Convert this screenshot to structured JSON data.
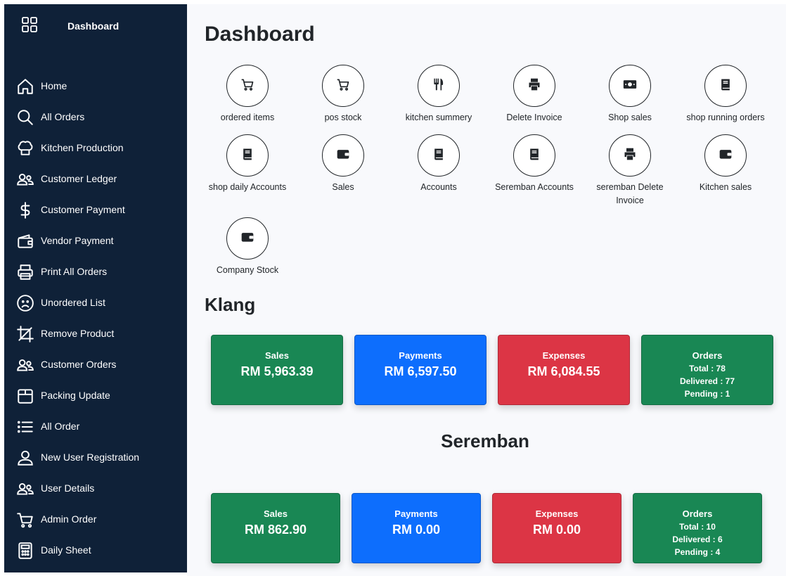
{
  "sidebar": {
    "brand": {
      "icon": "grid-icon",
      "title": "Dashboard"
    },
    "items": [
      {
        "label": "Home",
        "icon": "home-icon"
      },
      {
        "label": "All Orders",
        "icon": "search-icon"
      },
      {
        "label": "Kitchen Production",
        "icon": "chef-hat-icon"
      },
      {
        "label": "Customer Ledger",
        "icon": "users-icon"
      },
      {
        "label": "Customer Payment",
        "icon": "dollar-icon"
      },
      {
        "label": "Vendor Payment",
        "icon": "wallet-icon"
      },
      {
        "label": "Print All Orders",
        "icon": "printer-icon"
      },
      {
        "label": "Unordered List",
        "icon": "sad-face-icon"
      },
      {
        "label": "Remove Product",
        "icon": "crop-icon"
      },
      {
        "label": "Customer Orders",
        "icon": "users-icon"
      },
      {
        "label": "Packing Update",
        "icon": "box-icon"
      },
      {
        "label": "All Order",
        "icon": "list-icon"
      },
      {
        "label": "New User Registration",
        "icon": "user-icon"
      },
      {
        "label": "User Details",
        "icon": "users-icon"
      },
      {
        "label": "Admin Order",
        "icon": "cart-icon"
      },
      {
        "label": "Daily Sheet",
        "icon": "calculator-icon"
      }
    ]
  },
  "main": {
    "title": "Dashboard",
    "quick_links": [
      {
        "label": "ordered items",
        "icon": "cart-icon"
      },
      {
        "label": "pos stock",
        "icon": "cart-icon"
      },
      {
        "label": "kitchen summery",
        "icon": "utensils-icon"
      },
      {
        "label": "Delete Invoice",
        "icon": "printer-icon"
      },
      {
        "label": "Shop sales",
        "icon": "money-icon"
      },
      {
        "label": "shop running orders",
        "icon": "book-icon"
      },
      {
        "label": "shop daily Accounts",
        "icon": "book-icon"
      },
      {
        "label": "Sales",
        "icon": "wallet-icon"
      },
      {
        "label": "Accounts",
        "icon": "book-icon"
      },
      {
        "label": "Seremban Accounts",
        "icon": "book-icon"
      },
      {
        "label": "seremban Delete Invoice",
        "icon": "printer-icon"
      },
      {
        "label": "Kitchen sales",
        "icon": "wallet-icon"
      },
      {
        "label": "Company Stock",
        "icon": "wallet-icon"
      }
    ],
    "klang": {
      "title": "Klang",
      "sales": {
        "label": "Sales",
        "value": "RM 5,963.39"
      },
      "payments": {
        "label": "Payments",
        "value": "RM 6,597.50"
      },
      "expenses": {
        "label": "Expenses",
        "value": "RM 6,084.55"
      },
      "orders": {
        "label": "Orders",
        "total": "Total : 78",
        "delivered": "Delivered : 77",
        "pending": "Pending : 1"
      }
    },
    "seremban": {
      "title": "Seremban",
      "sales": {
        "label": "Sales",
        "value": "RM 862.90"
      },
      "payments": {
        "label": "Payments",
        "value": "RM 0.00"
      },
      "expenses": {
        "label": "Expenses",
        "value": "RM 0.00"
      },
      "orders": {
        "label": "Orders",
        "total": "Total : 10",
        "delivered": "Delivered : 6",
        "pending": "Pending : 4"
      }
    }
  },
  "colors": {
    "sidebar_bg": "#0f2138",
    "success": "#198754",
    "primary": "#0d6efd",
    "danger": "#dc3545"
  }
}
